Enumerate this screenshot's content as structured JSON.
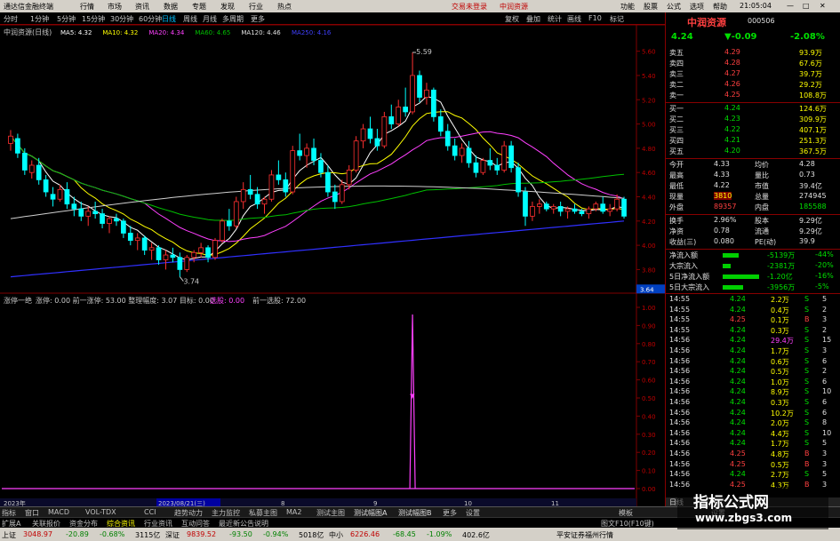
{
  "titlebar": {
    "app_name": "通达信金融终端",
    "menu": [
      "行情",
      "市场",
      "资讯",
      "数据",
      "专题",
      "发现",
      "行业",
      "热点"
    ],
    "center_a": "交易未登录",
    "center_b": "中润资源",
    "right": [
      "功能",
      "股票",
      "公式",
      "选项",
      "帮助"
    ],
    "clock": "21:05:04"
  },
  "periods": [
    "分时",
    "1分钟",
    "5分钟",
    "15分钟",
    "30分钟",
    "60分钟",
    "日线",
    "周线",
    "月线",
    "多周期",
    "更多"
  ],
  "toolbar_right": [
    "复权",
    "叠加",
    "统计",
    "画线",
    "F10",
    "标记"
  ],
  "main_chart": {
    "title": "中润资源(日线)",
    "ma": [
      {
        "label": "MA5: 4.32",
        "color": "#ffffff"
      },
      {
        "label": "MA10: 4.32",
        "color": "#ffff00"
      },
      {
        "label": "MA20: 4.34",
        "color": "#ff40ff"
      },
      {
        "label": "MA60: 4.65",
        "color": "#00c000"
      },
      {
        "label": "MA120: 4.46",
        "color": "#e0e0e0"
      },
      {
        "label": "MA250: 4.16",
        "color": "#4040ff"
      }
    ],
    "high_label": "5.59",
    "low_label": "3.74",
    "price_ticks": [
      "5.60",
      "5.40",
      "5.20",
      "5.00",
      "4.80",
      "4.60",
      "4.40",
      "4.20",
      "4.00",
      "3.80"
    ],
    "cursor_price": "3.64",
    "candles": [
      [
        4.84,
        4.95,
        4.78,
        4.9
      ],
      [
        4.88,
        4.92,
        4.72,
        4.76
      ],
      [
        4.76,
        4.8,
        4.58,
        4.62
      ],
      [
        4.6,
        4.7,
        4.55,
        4.66
      ],
      [
        4.66,
        4.72,
        4.5,
        4.54
      ],
      [
        4.54,
        4.58,
        4.4,
        4.44
      ],
      [
        4.42,
        4.48,
        4.32,
        4.38
      ],
      [
        4.38,
        4.5,
        4.36,
        4.46
      ],
      [
        4.46,
        4.52,
        4.3,
        4.34
      ],
      [
        4.34,
        4.4,
        4.24,
        4.3
      ],
      [
        4.3,
        4.36,
        4.2,
        4.24
      ],
      [
        4.24,
        4.32,
        4.16,
        4.28
      ],
      [
        4.28,
        4.36,
        4.22,
        4.26
      ],
      [
        4.26,
        4.3,
        4.14,
        4.18
      ],
      [
        4.18,
        4.24,
        4.1,
        4.22
      ],
      [
        4.22,
        4.26,
        4.16,
        4.2
      ],
      [
        4.2,
        4.22,
        4.06,
        4.1
      ],
      [
        4.1,
        4.16,
        4.0,
        4.04
      ],
      [
        4.04,
        4.1,
        3.96,
        4.06
      ],
      [
        4.06,
        4.08,
        3.92,
        3.96
      ],
      [
        3.96,
        4.02,
        3.88,
        3.98
      ],
      [
        3.98,
        4.0,
        3.84,
        3.88
      ],
      [
        3.88,
        3.96,
        3.8,
        3.92
      ],
      [
        3.92,
        3.98,
        3.86,
        3.9
      ],
      [
        3.9,
        3.94,
        3.74,
        3.8
      ],
      [
        3.8,
        3.92,
        3.78,
        3.9
      ],
      [
        3.9,
        3.96,
        3.86,
        3.94
      ],
      [
        3.94,
        4.02,
        3.9,
        3.98
      ],
      [
        3.98,
        4.0,
        3.86,
        3.9
      ],
      [
        3.9,
        4.06,
        3.88,
        4.04
      ],
      [
        4.04,
        4.22,
        4.02,
        4.2
      ],
      [
        4.2,
        4.3,
        4.12,
        4.16
      ],
      [
        4.16,
        4.4,
        4.14,
        4.36
      ],
      [
        4.36,
        4.52,
        4.3,
        4.46
      ],
      [
        4.46,
        4.58,
        4.38,
        4.42
      ],
      [
        4.42,
        4.48,
        4.3,
        4.34
      ],
      [
        4.34,
        4.4,
        4.26,
        4.38
      ],
      [
        4.38,
        4.62,
        4.36,
        4.58
      ],
      [
        4.58,
        4.7,
        4.5,
        4.54
      ],
      [
        4.54,
        4.6,
        4.4,
        4.44
      ],
      [
        4.44,
        4.82,
        4.42,
        4.78
      ],
      [
        4.78,
        4.92,
        4.7,
        4.74
      ],
      [
        4.74,
        4.84,
        4.64,
        4.8
      ],
      [
        4.8,
        4.88,
        4.66,
        4.7
      ],
      [
        4.7,
        4.76,
        4.56,
        4.6
      ],
      [
        4.6,
        4.66,
        4.4,
        4.44
      ],
      [
        4.44,
        4.5,
        4.3,
        4.36
      ],
      [
        4.36,
        4.54,
        4.34,
        4.5
      ],
      [
        4.5,
        4.66,
        4.46,
        4.62
      ],
      [
        4.62,
        4.9,
        4.6,
        4.86
      ],
      [
        4.86,
        5.0,
        4.8,
        4.96
      ],
      [
        4.96,
        5.06,
        4.84,
        4.88
      ],
      [
        4.88,
        4.96,
        4.78,
        4.82
      ],
      [
        4.82,
        5.1,
        4.8,
        5.06
      ],
      [
        5.06,
        5.16,
        4.96,
        5.0
      ],
      [
        5.0,
        5.2,
        4.98,
        5.14
      ],
      [
        5.14,
        5.3,
        5.06,
        5.1
      ],
      [
        5.1,
        5.59,
        5.08,
        5.4
      ],
      [
        5.4,
        5.44,
        5.18,
        5.22
      ],
      [
        5.22,
        5.34,
        5.16,
        5.28
      ],
      [
        5.28,
        5.3,
        5.02,
        5.06
      ],
      [
        5.06,
        5.12,
        4.9,
        4.94
      ],
      [
        4.94,
        5.0,
        4.78,
        4.82
      ],
      [
        4.82,
        4.88,
        4.7,
        4.74
      ],
      [
        4.74,
        4.84,
        4.68,
        4.8
      ],
      [
        4.8,
        4.86,
        4.64,
        4.68
      ],
      [
        4.68,
        4.74,
        4.56,
        4.6
      ],
      [
        4.6,
        4.72,
        4.58,
        4.7
      ],
      [
        4.7,
        4.8,
        4.62,
        4.66
      ],
      [
        4.66,
        4.72,
        4.58,
        4.62
      ],
      [
        4.62,
        4.86,
        4.6,
        4.82
      ],
      [
        4.82,
        4.86,
        4.6,
        4.64
      ],
      [
        4.64,
        4.68,
        4.4,
        4.44
      ],
      [
        4.44,
        4.48,
        4.16,
        4.24
      ],
      [
        4.24,
        4.36,
        4.2,
        4.32
      ],
      [
        4.32,
        4.38,
        4.26,
        4.34
      ],
      [
        4.34,
        4.36,
        4.28,
        4.3
      ],
      [
        4.3,
        4.34,
        4.26,
        4.32
      ],
      [
        4.32,
        4.36,
        4.24,
        4.28
      ],
      [
        4.28,
        4.32,
        4.22,
        4.3
      ],
      [
        4.3,
        4.34,
        4.26,
        4.28
      ],
      [
        4.28,
        4.3,
        4.24,
        4.26
      ],
      [
        4.26,
        4.32,
        4.22,
        4.3
      ],
      [
        4.3,
        4.36,
        4.28,
        4.34
      ],
      [
        4.34,
        4.4,
        4.26,
        4.28
      ],
      [
        4.28,
        4.34,
        4.24,
        4.3
      ],
      [
        4.3,
        4.42,
        4.28,
        4.38
      ],
      [
        4.38,
        4.4,
        4.22,
        4.24
      ]
    ],
    "date_axis": [
      "2023年",
      "2023/08/21(三)",
      "8",
      "9",
      "10",
      "11"
    ]
  },
  "indicator": {
    "title": "涨停一绝",
    "params": "涨停: 0.00   前一涨停: 53.00   整理幅度: 3.07   目标: 0.00",
    "params2_label": "选股: 0.00",
    "params3": "前一选股: 72.00",
    "ticks": [
      "1.00",
      "0.90",
      "0.80",
      "0.70",
      "0.60",
      "0.50",
      "0.40",
      "0.30",
      "0.20",
      "0.10",
      "0.00"
    ],
    "spike_index": 57
  },
  "right_panel": {
    "name": "中润资源",
    "code": "000506",
    "price": "4.24",
    "change": "▼-0.09",
    "pct": "-2.08%",
    "asks": [
      {
        "label": "卖五",
        "price": "4.29",
        "vol": "93.9万"
      },
      {
        "label": "卖四",
        "price": "4.28",
        "vol": "67.6万"
      },
      {
        "label": "卖三",
        "price": "4.27",
        "vol": "39.7万"
      },
      {
        "label": "卖二",
        "price": "4.26",
        "vol": "29.2万"
      },
      {
        "label": "卖一",
        "price": "4.25",
        "vol": "108.8万"
      }
    ],
    "bids": [
      {
        "label": "买一",
        "price": "4.24",
        "vol": "124.6万"
      },
      {
        "label": "买二",
        "price": "4.23",
        "vol": "309.9万"
      },
      {
        "label": "买三",
        "price": "4.22",
        "vol": "407.1万"
      },
      {
        "label": "买四",
        "price": "4.21",
        "vol": "251.3万"
      },
      {
        "label": "买五",
        "price": "4.20",
        "vol": "367.5万"
      }
    ],
    "stats": [
      {
        "k1": "今开",
        "v1": "4.33",
        "k2": "均价",
        "v2": "4.28"
      },
      {
        "k1": "最高",
        "v1": "4.33",
        "k2": "量比",
        "v2": "0.73"
      },
      {
        "k1": "最低",
        "v1": "4.22",
        "k2": "市值",
        "v2": "39.4亿"
      },
      {
        "k1": "现量",
        "v1": "3810",
        "k2": "总量",
        "v2": "274945"
      },
      {
        "k1": "外盘",
        "v1": "89357",
        "k2": "内盘",
        "v2": "185588"
      }
    ],
    "fin": [
      {
        "k1": "换手",
        "v1": "2.96%",
        "k2": "股本",
        "v2": "9.29亿"
      },
      {
        "k1": "净资",
        "v1": "0.78",
        "k2": "流通",
        "v2": "9.29亿"
      },
      {
        "k1": "收益(三)",
        "v1": "0.080",
        "k2": "PE(动)",
        "v2": "39.9"
      }
    ],
    "flows": [
      {
        "label": "净流入额",
        "bar": 0.4,
        "val": "-5139万",
        "pct": "-44%"
      },
      {
        "label": "大宗流入",
        "bar": 0.2,
        "val": "-2381万",
        "pct": "-20%"
      },
      {
        "label": "5日净流入额",
        "bar": 0.9,
        "val": "-1.20亿",
        "pct": "-16%"
      },
      {
        "label": "5日大宗流入",
        "bar": 0.5,
        "val": "-3956万",
        "pct": "-5%"
      }
    ],
    "ticks": [
      {
        "t": "14:55",
        "p": "4.24",
        "v": "2.2万",
        "s": "S",
        "n": "5"
      },
      {
        "t": "14:55",
        "p": "4.24",
        "v": "0.4万",
        "s": "S",
        "n": "2"
      },
      {
        "t": "14:55",
        "p": "4.25",
        "v": "0.1万",
        "s": "B",
        "n": "3"
      },
      {
        "t": "14:55",
        "p": "4.24",
        "v": "0.3万",
        "s": "S",
        "n": "2"
      },
      {
        "t": "14:56",
        "p": "4.24",
        "v": "29.4万",
        "s": "S",
        "n": "15"
      },
      {
        "t": "14:56",
        "p": "4.24",
        "v": "1.7万",
        "s": "S",
        "n": "3"
      },
      {
        "t": "14:56",
        "p": "4.24",
        "v": "0.6万",
        "s": "S",
        "n": "6"
      },
      {
        "t": "14:56",
        "p": "4.24",
        "v": "0.5万",
        "s": "S",
        "n": "2"
      },
      {
        "t": "14:56",
        "p": "4.24",
        "v": "1.0万",
        "s": "S",
        "n": "6"
      },
      {
        "t": "14:56",
        "p": "4.24",
        "v": "8.9万",
        "s": "S",
        "n": "10"
      },
      {
        "t": "14:56",
        "p": "4.24",
        "v": "0.3万",
        "s": "S",
        "n": "6"
      },
      {
        "t": "14:56",
        "p": "4.24",
        "v": "10.2万",
        "s": "S",
        "n": "6"
      },
      {
        "t": "14:56",
        "p": "4.24",
        "v": "2.0万",
        "s": "S",
        "n": "8"
      },
      {
        "t": "14:56",
        "p": "4.24",
        "v": "4.4万",
        "s": "S",
        "n": "10"
      },
      {
        "t": "14:56",
        "p": "4.24",
        "v": "1.7万",
        "s": "S",
        "n": "5"
      },
      {
        "t": "14:56",
        "p": "4.25",
        "v": "4.8万",
        "s": "B",
        "n": "3"
      },
      {
        "t": "14:56",
        "p": "4.25",
        "v": "0.5万",
        "s": "B",
        "n": "3"
      },
      {
        "t": "14:56",
        "p": "4.24",
        "v": "2.7万",
        "s": "S",
        "n": "5"
      },
      {
        "t": "14:56",
        "p": "4.25",
        "v": "4.3万",
        "s": "B",
        "n": "3"
      }
    ],
    "bottom_tab": "日线"
  },
  "bottom_tabs": [
    "指标",
    "窗口",
    "MACD",
    "VOL-TDX",
    "CCI",
    "趋势动力",
    "主力监控",
    "私募主图",
    "MA2",
    "测试主图",
    "测试幅图A",
    "测试幅图B",
    "更多",
    "设置"
  ],
  "bottom_tabs2": [
    "扩展A",
    "关联报价",
    "资金分布",
    "综合资讯",
    "行业资讯",
    "互动问答",
    "最近新公告说明"
  ],
  "bottom_right": [
    "模板",
    "图文F10(F10键)",
    "设置"
  ],
  "statusbar": [
    {
      "name": "上证",
      "val": "3048.97",
      "chg": "-20.89",
      "pct": "-0.68%",
      "amt": "3115亿"
    },
    {
      "name": "深证",
      "val": "9839.52",
      "chg": "-93.50",
      "pct": "-0.94%",
      "amt": "5018亿"
    },
    {
      "name": "中小",
      "val": "6226.46",
      "chg": "-68.45",
      "pct": "-1.09%",
      "amt": "402.6亿"
    }
  ],
  "statusbar_right": "平安证券福州行情",
  "watermark": {
    "title": "指标公式网",
    "url": "www.zbgs3.com"
  }
}
